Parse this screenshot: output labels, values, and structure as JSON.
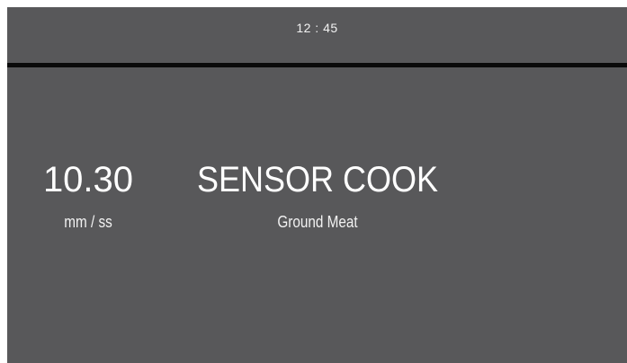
{
  "status_bar": {
    "clock": "12 : 45"
  },
  "timer": {
    "value": "10.30",
    "unit": "mm / ss"
  },
  "program": {
    "mode": "SENSOR COOK",
    "food": "Ground Meat"
  },
  "colors": {
    "screen_background": "#58585a",
    "divider": "#0a0a0a",
    "text": "#ffffff"
  }
}
